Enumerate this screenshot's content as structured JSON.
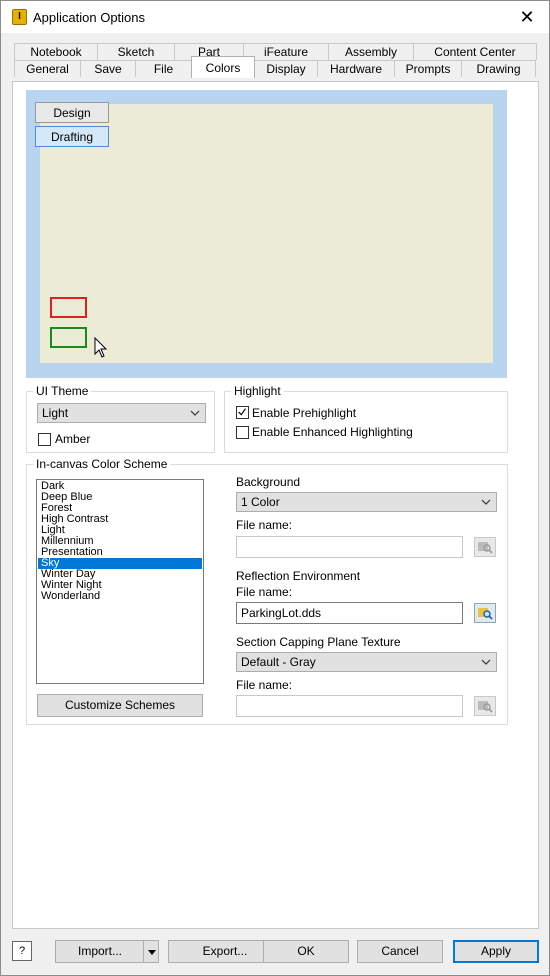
{
  "window": {
    "title": "Application Options",
    "close_glyph": "✕",
    "icon_glyph": "I"
  },
  "tabs": {
    "back_row": [
      "Notebook",
      "Sketch",
      "Part",
      "iFeature",
      "Assembly",
      "Content Center"
    ],
    "front_row": [
      "General",
      "Save",
      "File",
      "Colors",
      "Display",
      "Hardware",
      "Prompts",
      "Drawing"
    ],
    "active": "Colors"
  },
  "preview": {
    "design_label": "Design",
    "drafting_label": "Drafting"
  },
  "ui_theme": {
    "group_label": "UI Theme",
    "selected": "Light",
    "amber_label": "Amber",
    "amber_checked": false
  },
  "highlight": {
    "group_label": "Highlight",
    "prehighlight_label": "Enable Prehighlight",
    "prehighlight_checked": true,
    "enhanced_label": "Enable Enhanced Highlighting",
    "enhanced_checked": false
  },
  "color_scheme": {
    "group_label": "In-canvas Color Scheme",
    "items": [
      "Dark",
      "Deep Blue",
      "Forest",
      "High Contrast",
      "Light",
      "Millennium",
      "Presentation",
      "Sky",
      "Winter Day",
      "Winter Night",
      "Wonderland"
    ],
    "selected": "Sky",
    "customize_label": "Customize Schemes"
  },
  "background": {
    "label": "Background",
    "selected": "1 Color",
    "file_label": "File name:",
    "file_value": ""
  },
  "reflection": {
    "label": "Reflection Environment",
    "file_label": "File name:",
    "file_value": "ParkingLot.dds"
  },
  "section_capping": {
    "label": "Section Capping Plane Texture",
    "selected": "Default - Gray",
    "file_label": "File name:",
    "file_value": ""
  },
  "footer": {
    "help_glyph": "?",
    "import_label": "Import...",
    "export_label": "Export...",
    "ok_label": "OK",
    "cancel_label": "Cancel",
    "apply_label": "Apply"
  },
  "colors": {
    "accent": "#0078d7",
    "preview_bg": "#b8d4ef",
    "canvas_bg": "#ecebd6",
    "rect_red": "#e02020",
    "rect_green": "#1a8a1a"
  }
}
